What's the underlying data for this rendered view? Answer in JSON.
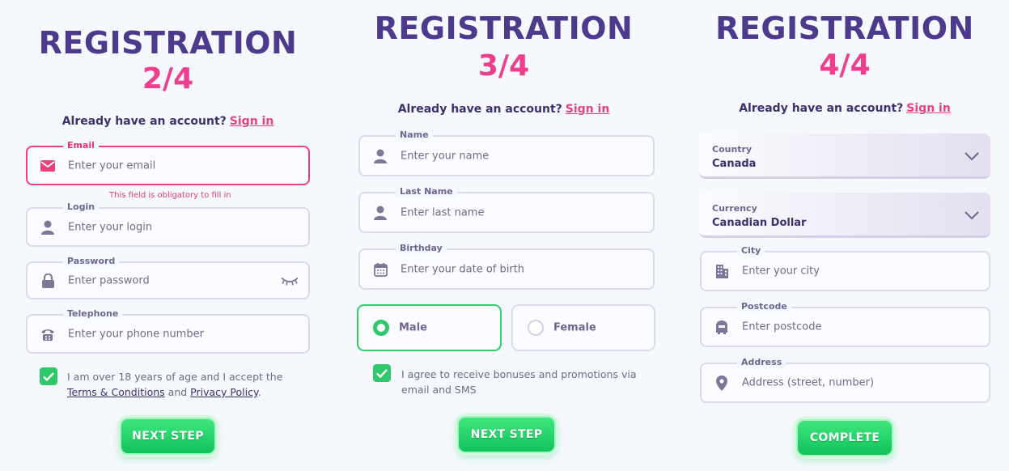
{
  "accent": {
    "purple": "#4e3a8c",
    "pink": "#ee3f8e",
    "green": "#2fc86a"
  },
  "step2": {
    "title": "REGISTRATION",
    "step": "2/4",
    "account_text": "Already have an account?",
    "signin": "Sign in",
    "email": {
      "label": "Email",
      "placeholder": "Enter your email",
      "icon": "envelope-icon",
      "error": "This field is obligatory to fill in"
    },
    "login": {
      "label": "Login",
      "placeholder": "Enter your login",
      "icon": "user-icon"
    },
    "password": {
      "label": "Password",
      "placeholder": "Enter password",
      "icon": "lock-icon",
      "toggle_icon": "eye-closed-icon"
    },
    "telephone": {
      "label": "Telephone",
      "placeholder": "Enter your phone number",
      "icon": "phone-icon"
    },
    "terms": {
      "checked": true,
      "text_1": "I am over 18 years of age and I accept the",
      "terms_link": "Terms & Conditions",
      "and": "and",
      "privacy_link": "Privacy Policy",
      "period": "."
    },
    "button": "NEXT STEP"
  },
  "step3": {
    "title": "REGISTRATION",
    "step": "3/4",
    "account_text": "Already have an account?",
    "signin": "Sign in",
    "name": {
      "label": "Name",
      "placeholder": "Enter your name",
      "icon": "user-icon"
    },
    "last_name": {
      "label": "Last Name",
      "placeholder": "Enter last name",
      "icon": "user-icon"
    },
    "birthday": {
      "label": "Birthday",
      "placeholder": "Enter your date of birth",
      "icon": "calendar-icon"
    },
    "gender": {
      "male": "Male",
      "female": "Female",
      "selected": "Male"
    },
    "bonuses": {
      "checked": true,
      "text": "I agree to receive bonuses and promotions via email and SMS"
    },
    "button": "NEXT STEP"
  },
  "step4": {
    "title": "REGISTRATION",
    "step": "4/4",
    "account_text": "Already have an account?",
    "signin": "Sign in",
    "country": {
      "label": "Country",
      "value": "Canada"
    },
    "currency": {
      "label": "Currency",
      "value": "Canadian Dollar"
    },
    "city": {
      "label": "City",
      "placeholder": "Enter your city",
      "icon": "building-icon"
    },
    "postcode": {
      "label": "Postcode",
      "placeholder": "Enter postcode",
      "icon": "mailbox-icon"
    },
    "address": {
      "label": "Address",
      "placeholder": "Address (street, number)",
      "icon": "location-pin-icon"
    },
    "button": "COMPLETE"
  }
}
